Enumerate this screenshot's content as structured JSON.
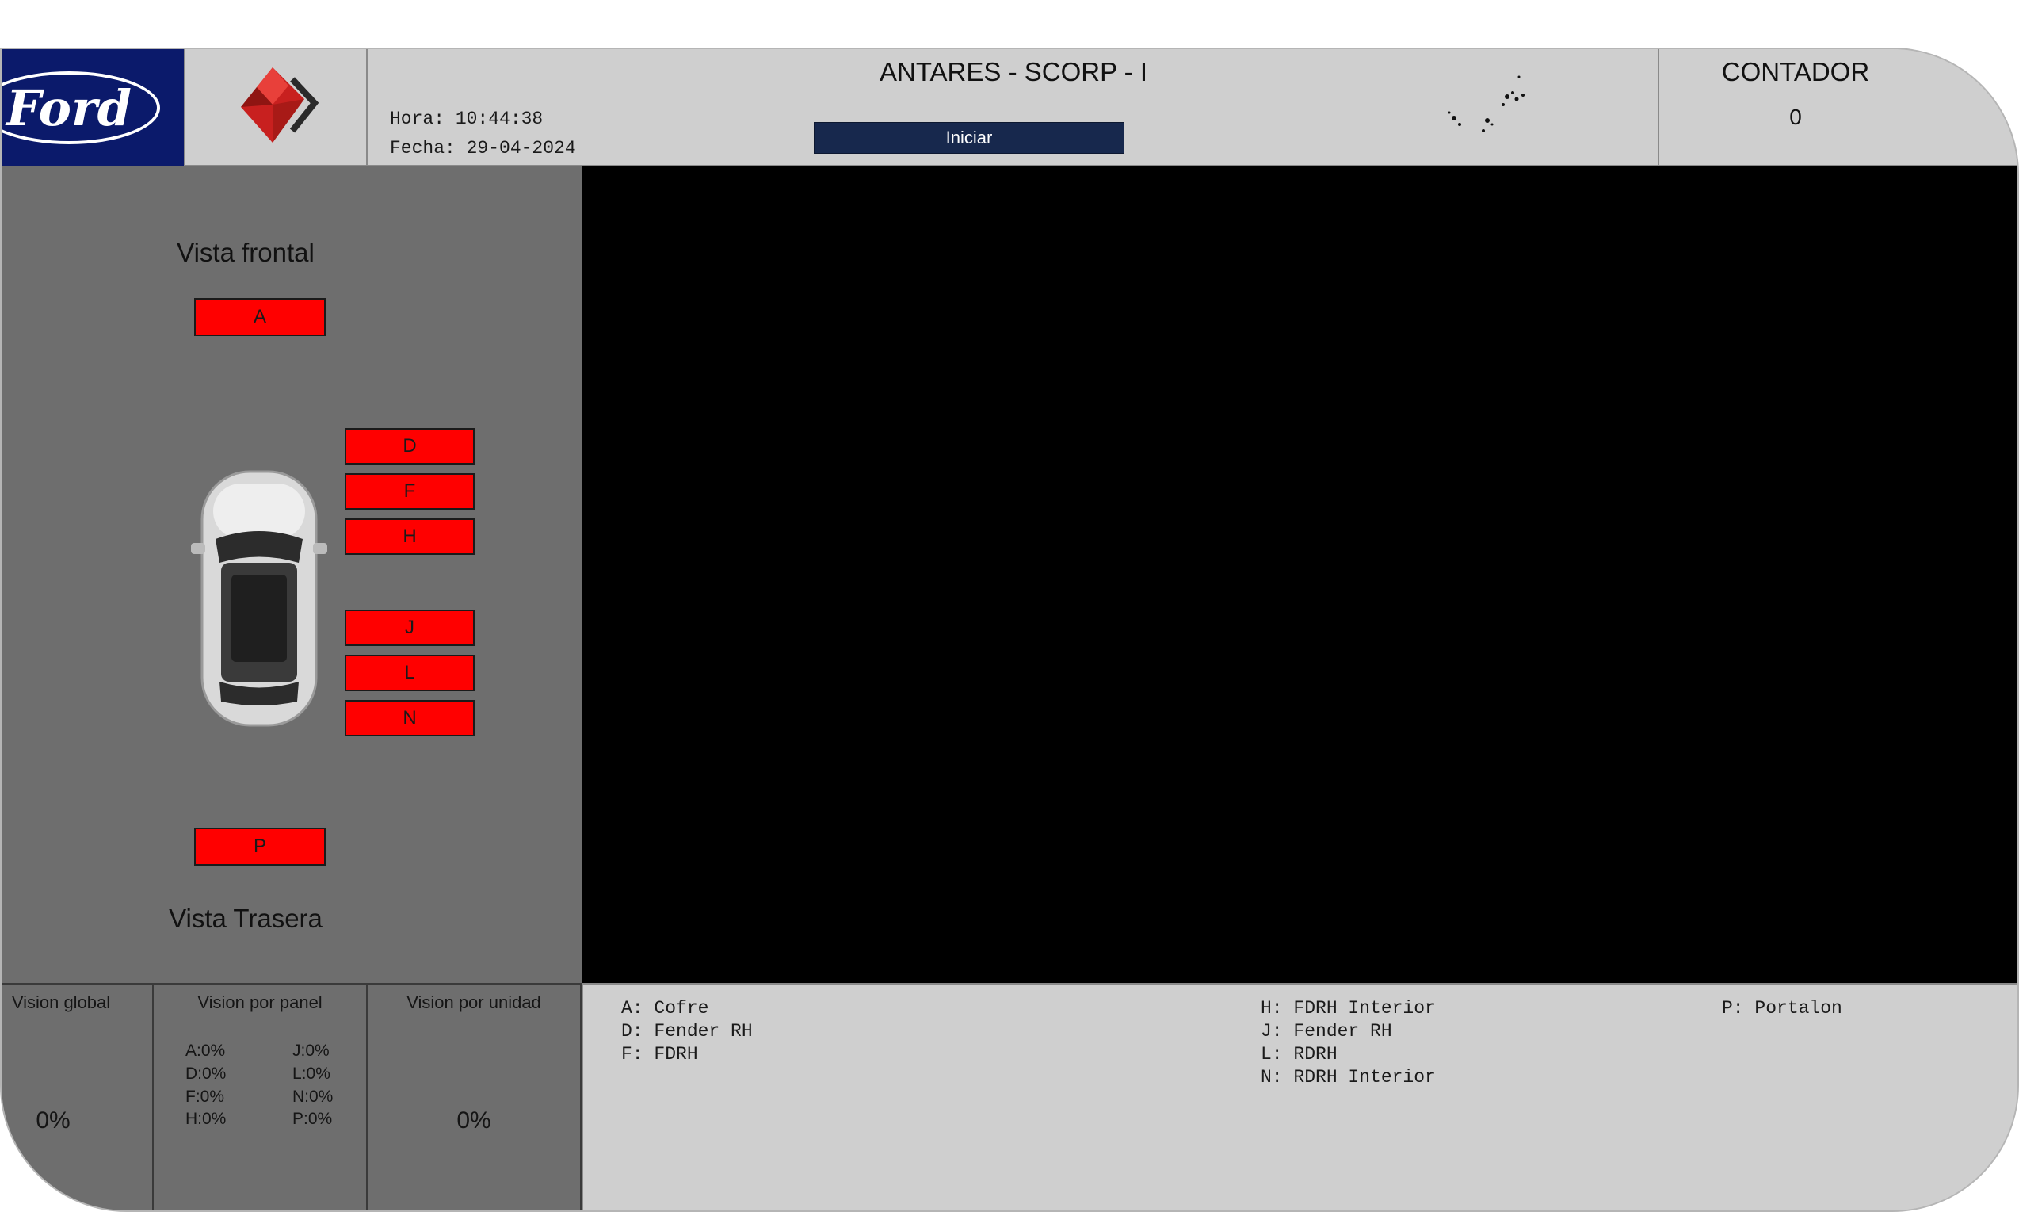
{
  "header": {
    "ford_logo_text": "Ford",
    "app_title": "ANTARES - SCORP - I",
    "hora": "Hora: 10:44:38",
    "fecha": "Fecha: 29-04-2024",
    "start_button": "Iniciar",
    "counter_label": "CONTADOR",
    "counter_value": "0"
  },
  "vehicle_view": {
    "front_label": "Vista frontal",
    "rear_label": "Vista Trasera",
    "zones": {
      "A": "A",
      "D": "D",
      "F": "F",
      "H": "H",
      "J": "J",
      "L": "L",
      "N": "N",
      "P": "P"
    }
  },
  "stats": {
    "global_title": "Vision global",
    "global_value": "0%",
    "panel_title": "Vision por panel",
    "panel_values": {
      "A": "A:0%",
      "D": "D:0%",
      "F": "F:0%",
      "H": "H:0%",
      "J": "J:0%",
      "L": "L:0%",
      "N": "N:0%",
      "P": "P:0%"
    },
    "unit_title": "Vision por unidad",
    "unit_value": "0%"
  },
  "legend": {
    "col1": [
      "A: Cofre",
      "D: Fender RH",
      "F: FDRH"
    ],
    "col2": [
      "H: FDRH Interior",
      "J: Fender RH",
      "L: RDRH",
      "N: RDRH Interior"
    ],
    "col3": [
      "P: Portalon"
    ]
  },
  "colors": {
    "ford_blue": "#0b1a6b",
    "zone_red": "#ff0000",
    "start_button": "#17284d",
    "panel_gray": "#6e6e6e",
    "header_gray": "#cfcfcf",
    "camera_bg": "#000000"
  }
}
